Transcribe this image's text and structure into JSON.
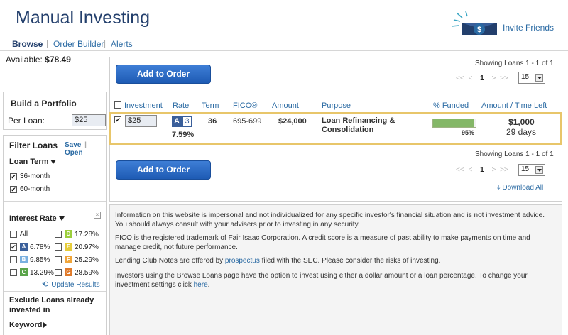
{
  "header": {
    "title": "Manual Investing",
    "invite_label": "Invite Friends",
    "invite_icon": "dollar-envelope-icon"
  },
  "nav": {
    "items": [
      "Browse",
      "Order Builder",
      "Alerts"
    ]
  },
  "sidebar": {
    "available_label": "Available:",
    "available_value": "$78.49",
    "build": {
      "title": "Build a Portfolio",
      "per_loan_label": "Per Loan:",
      "per_loan_value": "$25"
    },
    "filter": {
      "title": "Filter Loans",
      "save_label": "Save",
      "sep": "|",
      "open_label": "Open",
      "loan_term_label": "Loan Term",
      "loan_terms": [
        {
          "label": "36-month",
          "checked": true
        },
        {
          "label": "60-month",
          "checked": true
        }
      ],
      "interest_rate_label": "Interest Rate",
      "all_label": "All",
      "grades": [
        {
          "grade": "A",
          "rate": "6.78%",
          "checked": true,
          "color": "#3a5f9a"
        },
        {
          "grade": "B",
          "rate": "9.85%",
          "checked": false,
          "color": "#7ab0e0"
        },
        {
          "grade": "C",
          "rate": "13.29%",
          "checked": false,
          "color": "#5aa44a"
        },
        {
          "grade": "D",
          "rate": "17.28%",
          "checked": false,
          "color": "#9ccf3c"
        },
        {
          "grade": "E",
          "rate": "20.97%",
          "checked": false,
          "color": "#e6cc3a"
        },
        {
          "grade": "F",
          "rate": "25.29%",
          "checked": false,
          "color": "#f0a53a"
        },
        {
          "grade": "G",
          "rate": "28.59%",
          "checked": false,
          "color": "#e07a2a"
        }
      ],
      "update_label": "Update Results",
      "exclude_label_1": "Exclude Loans already",
      "exclude_label_2": "invested in",
      "keyword_label": "Keyword"
    }
  },
  "main": {
    "add_to_order_label": "Add to Order",
    "showing_label": "Showing Loans 1 - 1 of 1",
    "pager": {
      "first": "<<",
      "prev": "<",
      "current": "1",
      "next": ">",
      "last": ">>"
    },
    "per_page": "15",
    "download_label": "Download All",
    "columns": [
      "Investment",
      "Rate",
      "Term",
      "FICO®",
      "Amount",
      "Purpose",
      "% Funded",
      "Amount / Time Left"
    ],
    "loan": {
      "checked": true,
      "investment": "$25",
      "grade": "A",
      "subgrade": "3",
      "rate": "7.59%",
      "term": "36",
      "fico": "695-699",
      "amount": "$24,000",
      "purpose_1": "Loan Refinancing &",
      "purpose_2": "Consolidation",
      "funded_fraction": 0.95,
      "funded_label": "95%",
      "amount_left": "$1,000",
      "time_left": "29 days"
    }
  },
  "disclaimer": {
    "p1": "Information on this website is impersonal and not individualized for any specific investor's financial situation and is not investment advice. You should always consult with your advisers prior to investing in any security.",
    "p2": "FICO is the registered trademark of Fair Isaac Corporation. A credit score is a measure of past ability to make payments on time and manage credit, not future performance.",
    "p3_pre": "Lending Club Notes are offered by ",
    "p3_link": "prospectus",
    "p3_post": " filed with the SEC. Please consider the risks of investing.",
    "p4_pre": "Investors using the Browse Loans page have the option to invest using either a dollar amount or a loan percentage. To change your investment settings click ",
    "p4_link": "here",
    "p4_post": "."
  }
}
